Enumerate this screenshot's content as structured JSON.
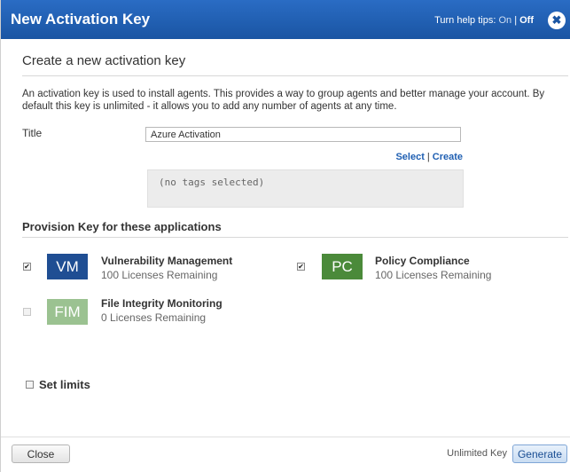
{
  "header": {
    "title": "New Activation Key",
    "help_tips_label": "Turn help tips:",
    "help_on": "On",
    "help_sep": "|",
    "help_off": "Off",
    "close_glyph": "✖"
  },
  "form": {
    "section_title": "Create a new activation key",
    "description": "An activation key is used to install agents. This provides a way to group agents and better manage your account. By default this key is unlimited - it allows you to add any number of agents at any time.",
    "title_label": "Title",
    "title_value": "Azure Activation",
    "tags_select": "Select",
    "tags_sep": "|",
    "tags_create": "Create",
    "tags_empty": "(no tags selected)"
  },
  "provision": {
    "title": "Provision Key for these applications",
    "apps": [
      {
        "badge": "VM",
        "name": "Vulnerability Management",
        "licenses": "100 Licenses Remaining",
        "checked": true,
        "enabled": true,
        "color": "#1f4e93"
      },
      {
        "badge": "PC",
        "name": "Policy Compliance",
        "licenses": "100 Licenses Remaining",
        "checked": true,
        "enabled": true,
        "color": "#4b8a3a"
      },
      {
        "badge": "FIM",
        "name": "File Integrity Monitoring",
        "licenses": "0 Licenses Remaining",
        "checked": false,
        "enabled": false,
        "color": "#9bc291"
      }
    ]
  },
  "limits": {
    "label": "Set limits",
    "checked": false
  },
  "footer": {
    "close_label": "Close",
    "key_type": "Unlimited Key",
    "generate_label": "Generate"
  },
  "colors": {
    "header_bg": "#1f5fb2",
    "link": "#1f5fb2"
  }
}
